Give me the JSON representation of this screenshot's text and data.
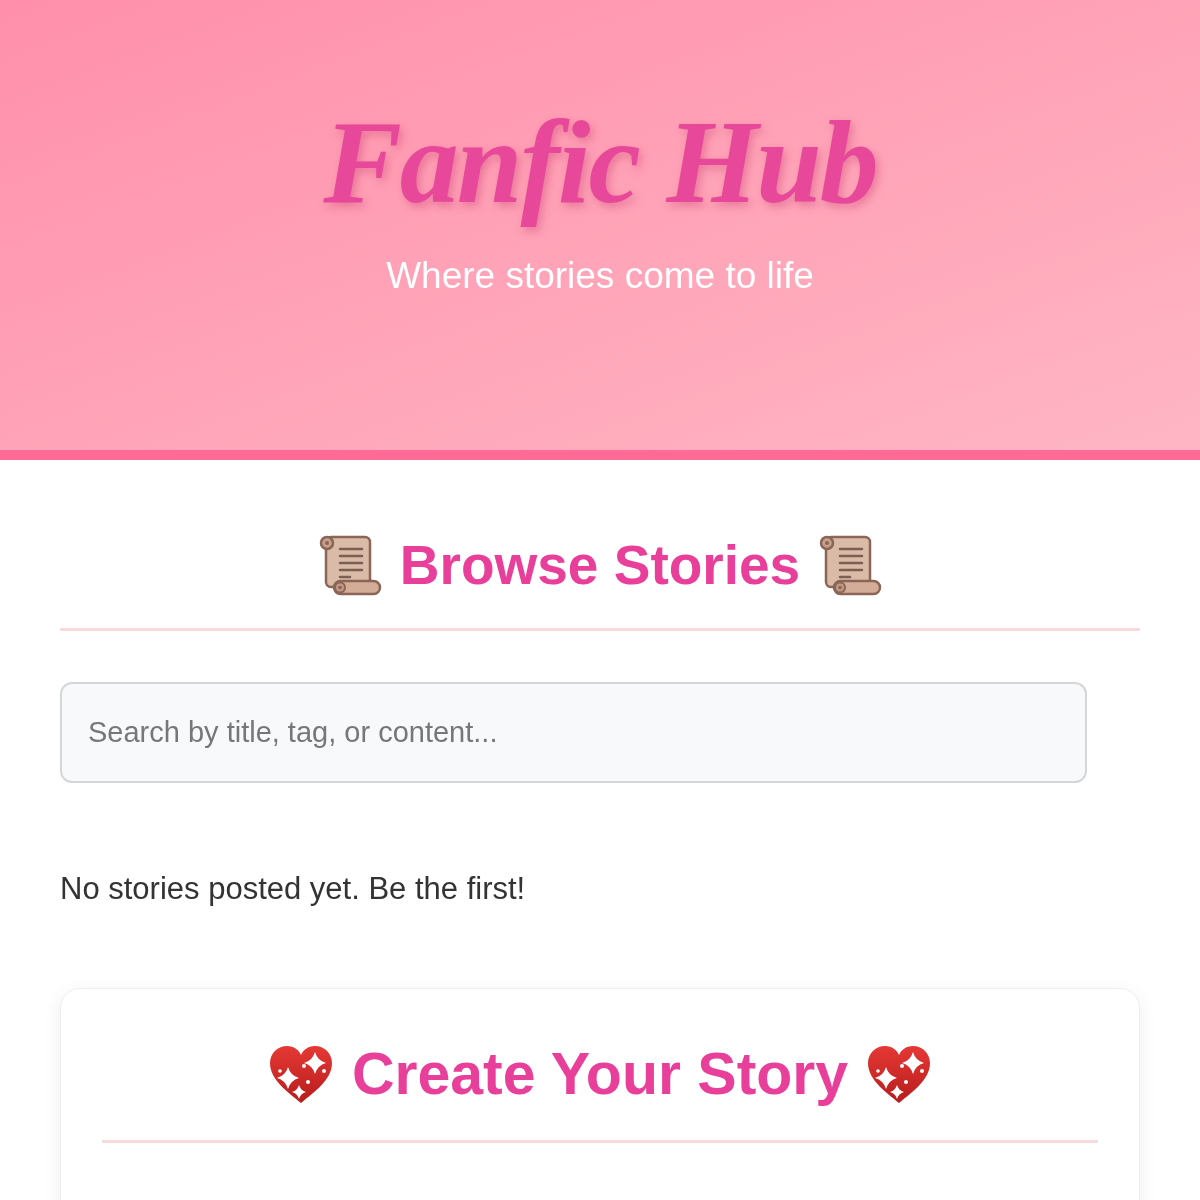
{
  "header": {
    "title": "Fanfic Hub",
    "subtitle": "Where stories come to life"
  },
  "browse": {
    "heading": "Browse Stories",
    "search": {
      "placeholder": "Search by title, tag, or content..."
    },
    "empty_message": "No stories posted yet. Be the first!"
  },
  "create": {
    "heading": "Create Your Story"
  }
}
